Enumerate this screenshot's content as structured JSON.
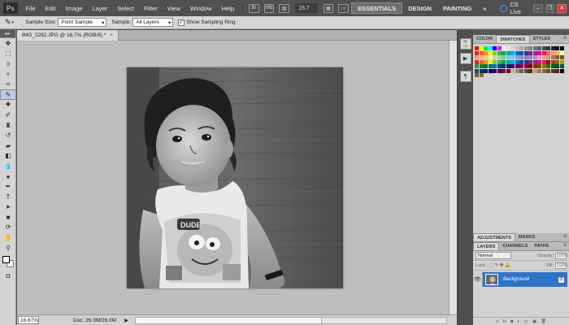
{
  "app": {
    "logo": "Ps"
  },
  "menu": [
    "File",
    "Edit",
    "Image",
    "Layer",
    "Select",
    "Filter",
    "View",
    "Window",
    "Help"
  ],
  "zoom_dropdown": "16.7",
  "workspaces": {
    "essentials": "ESSENTIALS",
    "design": "DESIGN",
    "painting": "PAINTING",
    "more": "»"
  },
  "cs_live": "CS Live",
  "options": {
    "sample_size_label": "Sample Size:",
    "sample_size_value": "Point Sample",
    "sample_label": "Sample:",
    "sample_value": "All Layers",
    "show_ring_label": "Show Sampling Ring",
    "show_ring_checked": true
  },
  "document": {
    "tab_title": "IMG_2292.JPG @ 16.7% (RGB/8) *",
    "close": "×",
    "status_zoom": "16.67%",
    "status_doc": "Doc: 26.0M/26.0M",
    "status_arrow": "▶"
  },
  "panels": {
    "swatch_tabs": [
      "COLOR",
      "SWATCHES",
      "STYLES"
    ],
    "swatch_tab_active": 1,
    "adjustment_tabs": [
      "ADJUSTMENTS",
      "MASKS"
    ],
    "layer_tabs": [
      "LAYERS",
      "CHANNELS",
      "PATHS"
    ],
    "blend_mode": "Normal",
    "opacity_label": "Opacity:",
    "opacity_value": "100%",
    "lock_label": "Lock:",
    "fill_label": "Fill:",
    "fill_value": "100%",
    "layer_name": "Background"
  },
  "colors": {
    "swatches": [
      "#ff0000",
      "#ffff00",
      "#00ff00",
      "#00ffff",
      "#0000ff",
      "#ff00ff",
      "#ffffff",
      "#ebebeb",
      "#d7d7d7",
      "#c3c3c3",
      "#afafaf",
      "#9b9b9b",
      "#878787",
      "#737373",
      "#5f5f5f",
      "#4b4b4b",
      "#373737",
      "#232323",
      "#0f0f0f",
      "#000000",
      "#ee1d24",
      "#f26522",
      "#f7941d",
      "#fff200",
      "#8dc63f",
      "#39b54a",
      "#00a651",
      "#00a99d",
      "#00aeef",
      "#0072bc",
      "#0054a6",
      "#2e3192",
      "#662d91",
      "#92278f",
      "#ec008c",
      "#ed145b",
      "#f26c4f",
      "#f69679",
      "#fbaf5d",
      "#fff799",
      "#f7977a",
      "#f9ad81",
      "#fdc68a",
      "#fff79a",
      "#c4df9b",
      "#a3d39c",
      "#82ca9c",
      "#7accc8",
      "#6dcff6",
      "#7ea7d8",
      "#8493ca",
      "#8882be",
      "#a187be",
      "#bc8dbf",
      "#f49ac2",
      "#f6989d",
      "#c69c6d",
      "#a67c52",
      "#8c6239",
      "#754c24",
      "#ed1c24",
      "#f26522",
      "#f7941d",
      "#fff200",
      "#8dc73f",
      "#39b54a",
      "#00a651",
      "#00a99d",
      "#00aeef",
      "#0072bc",
      "#0054a6",
      "#2e3192",
      "#662d91",
      "#92278f",
      "#ec008c",
      "#ed145b",
      "#9e0b0f",
      "#a0410d",
      "#a36209",
      "#aba000",
      "#598527",
      "#1a7b30",
      "#007236",
      "#00746b",
      "#0076a3",
      "#004b80",
      "#003471",
      "#1b1464",
      "#440e62",
      "#630460",
      "#9e005d",
      "#9e0039",
      "#790000",
      "#7b2e00",
      "#7d4900",
      "#827b00",
      "#406618",
      "#005e20",
      "#005826",
      "#005952",
      "#005b7f",
      "#003663",
      "#002157",
      "#0d004c",
      "#32004b",
      "#4b0049",
      "#7b0046",
      "#7a0026",
      "#c7b299",
      "#998675",
      "#736357",
      "#534741",
      "#37302d",
      "#c69c6d",
      "#a67c52",
      "#8c6239",
      "#754c24",
      "#603913",
      "#362f2d",
      "#000000",
      "#7d5a2d",
      "#8b6a3a"
    ]
  }
}
